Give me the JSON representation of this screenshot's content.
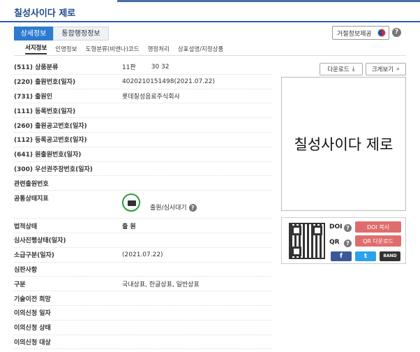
{
  "header": {
    "title": "칠성사이다 제로"
  },
  "tabs": [
    {
      "label": "상세정보",
      "active": true
    },
    {
      "label": "통합행정정보",
      "active": false
    }
  ],
  "refuse_button": "거절정보제공",
  "subnav": [
    "서지정보",
    "인명정보",
    "도형분류(비엔나)코드",
    "행정처리",
    "상표설명/지정상품"
  ],
  "actions": {
    "download": "다운로드",
    "zoom": "크게보기"
  },
  "fields": [
    {
      "label": "(511) 상품분류",
      "value": "11판",
      "extra": "30 32"
    },
    {
      "label": "(220) 출원번호(일자)",
      "value": "4020210151498(2021.07.22)"
    },
    {
      "label": "(731) 출원인",
      "value": "롯데칠성음료주식회사"
    },
    {
      "label": "(111) 등록번호(일자)",
      "value": ""
    },
    {
      "label": "(260) 출원공고번호(일자)",
      "value": ""
    },
    {
      "label": "(112) 등록공고번호(일자)",
      "value": ""
    },
    {
      "label": "(641) 원출원번호(일자)",
      "value": ""
    },
    {
      "label": "(300) 우선권주장번호(일자)",
      "value": ""
    },
    {
      "label": "관련출원번호",
      "value": ""
    },
    {
      "label": "공통상태지표",
      "value": "출원/심사대기"
    },
    {
      "label": "법적상태",
      "value": "출 원"
    },
    {
      "label": "심사진행상태(일자)",
      "value": ""
    },
    {
      "label": "소급구분(일자)",
      "value": "(2021.07.22)"
    },
    {
      "label": "심판사항",
      "value": ""
    },
    {
      "label": "구분",
      "value": "국내상표, 한글상표, 일반상표"
    },
    {
      "label": "기술이전 희망",
      "value": ""
    },
    {
      "label": "이의신청 일자",
      "value": ""
    },
    {
      "label": "이의신청 상태",
      "value": ""
    },
    {
      "label": "이의신청 대상",
      "value": ""
    }
  ],
  "mark_image_text": "칠성사이다 제로",
  "qr_panel": {
    "doi_label": "DOI",
    "qr_label": "QR",
    "doi_copy": "DOI 복사",
    "qr_download": "QR 다운로드",
    "social": [
      "f",
      "t",
      "BAND"
    ]
  },
  "colors": {
    "accent": "#2d7bd1",
    "title": "#1f4a8c",
    "red": "#e06d6d",
    "facebook": "#3b5998",
    "twitter": "#2aa3ef",
    "band": "#333333"
  }
}
